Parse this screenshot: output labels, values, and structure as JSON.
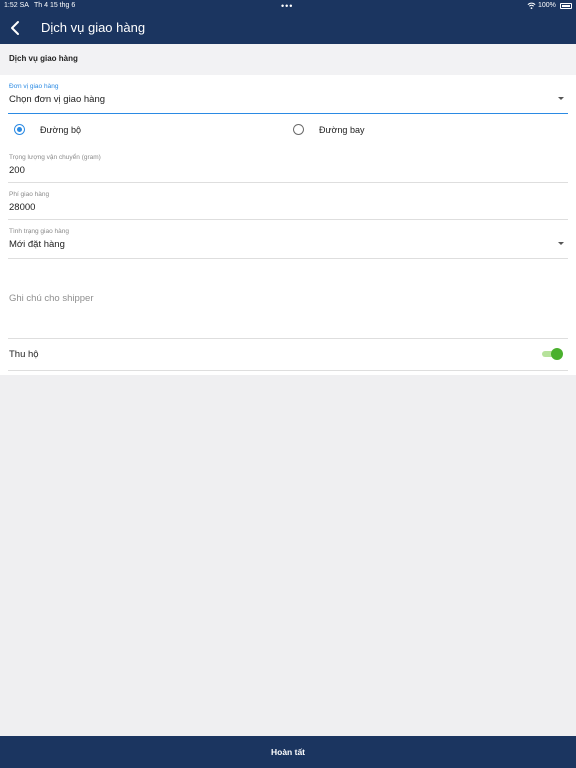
{
  "status_bar": {
    "time": "1:52 SA",
    "date": "Th 4 15 thg 6",
    "dots": "•••",
    "battery": "100%"
  },
  "nav": {
    "title": "Dịch vụ giao hàng"
  },
  "section": {
    "title": "Dịch vụ giao hàng"
  },
  "form": {
    "carrier": {
      "label": "Đơn vị giao hàng",
      "value": "Chọn đơn vị giao hàng"
    },
    "shipping_method": {
      "options": [
        {
          "label": "Đường bộ",
          "selected": true
        },
        {
          "label": "Đường bay",
          "selected": false
        }
      ]
    },
    "weight": {
      "label": "Trọng lượng vận chuyển (gram)",
      "value": "200"
    },
    "fee": {
      "label": "Phí giao hàng",
      "value": "28000"
    },
    "status": {
      "label": "Tình trạng giao hàng",
      "value": "Mới đặt hàng"
    },
    "note": {
      "placeholder": "Ghi chú cho shipper"
    },
    "cod": {
      "label": "Thu hộ",
      "enabled": true
    }
  },
  "footer": {
    "button_label": "Hoàn tất"
  },
  "colors": {
    "primary": "#1b3560",
    "accent": "#2b8ae3",
    "toggle_on": "#4ab02d"
  },
  "icons": [
    "back-chevron-icon",
    "wifi-icon",
    "battery-icon",
    "dropdown-arrow-icon"
  ]
}
